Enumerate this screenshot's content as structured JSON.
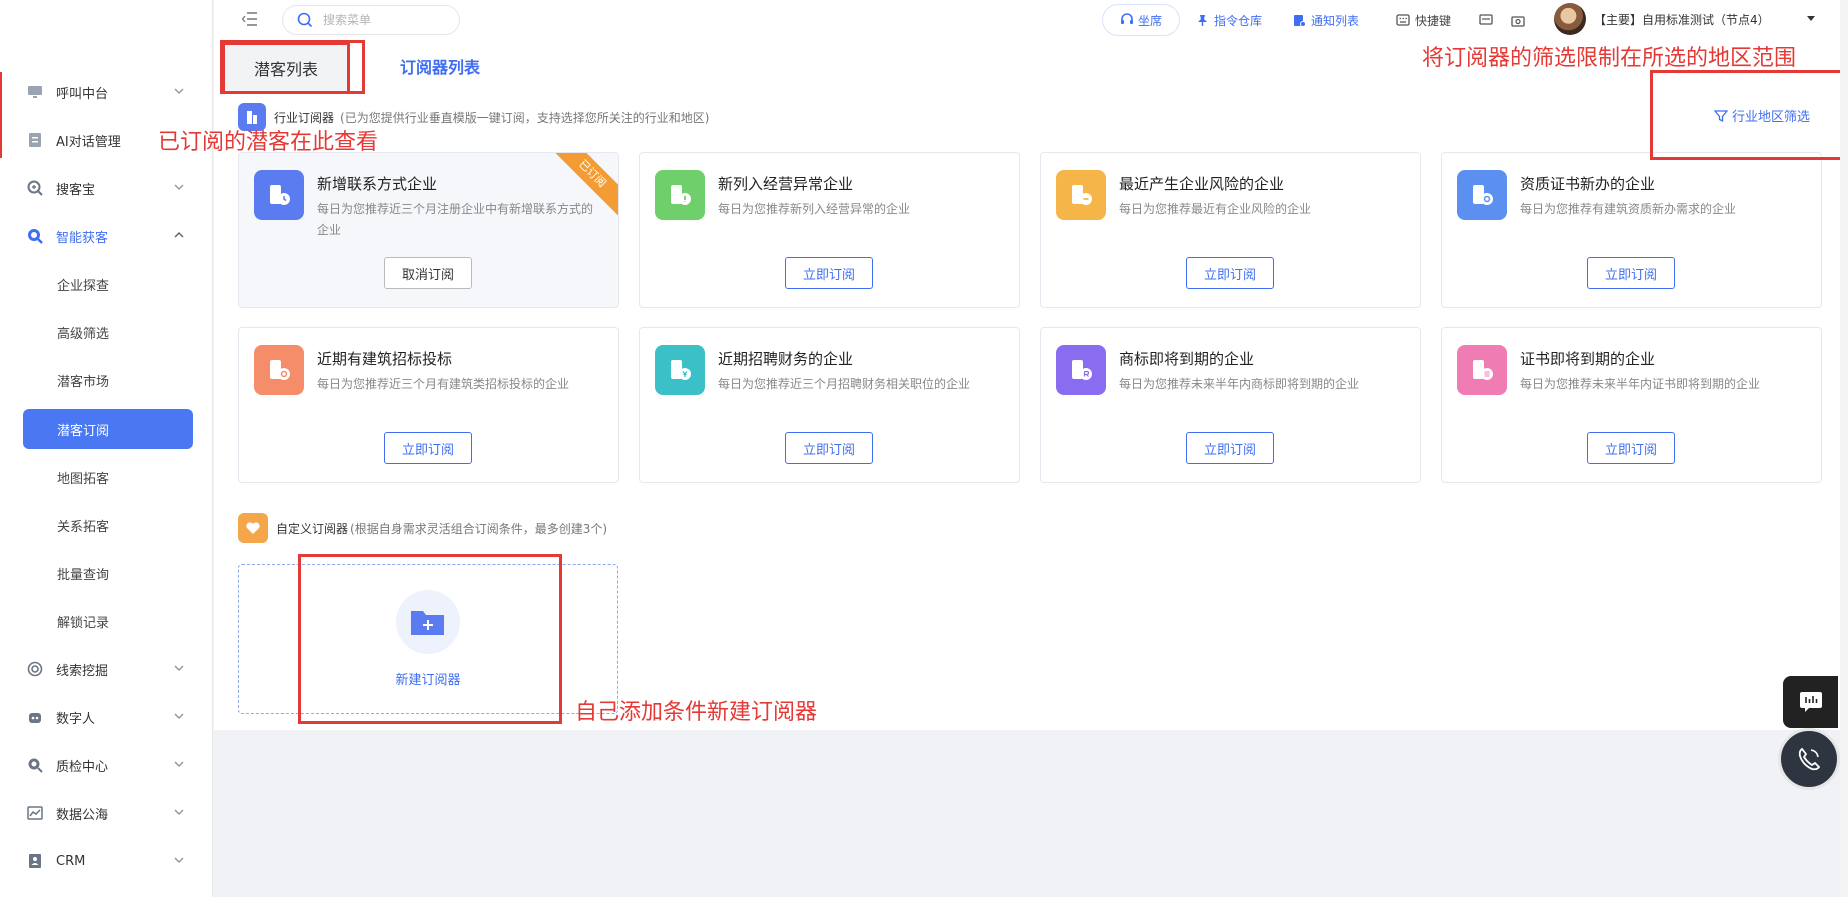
{
  "sidebar": {
    "menu": [
      {
        "label": "呼叫中台",
        "icon": "monitor-icon"
      },
      {
        "label": "AI对话管理",
        "icon": "document-icon"
      },
      {
        "label": "搜客宝",
        "icon": "search-plus-icon"
      },
      {
        "label": "智能获客",
        "icon": "search-icon"
      }
    ],
    "sub": [
      "企业探查",
      "高级筛选",
      "潜客市场",
      "潜客订阅",
      "地图拓客",
      "关系拓客",
      "批量查询",
      "解锁记录"
    ],
    "bottom_menu": [
      {
        "label": "线索挖掘",
        "icon": "target-icon"
      },
      {
        "label": "数字人",
        "icon": "robot-icon"
      },
      {
        "label": "质检中心",
        "icon": "magnifier-icon"
      },
      {
        "label": "数据公海",
        "icon": "chart-icon"
      },
      {
        "label": "CRM",
        "icon": "contact-icon"
      }
    ]
  },
  "header": {
    "search_placeholder": "搜索菜单",
    "seat": "坐席",
    "command": "指令仓库",
    "notice": "通知列表",
    "shortcut": "快捷键",
    "user": "【主要】自用标准测试（节点4）"
  },
  "tabs": [
    "潜客列表",
    "订阅器列表"
  ],
  "industry": {
    "title": "行业订阅器",
    "desc": "(已为您提供行业垂直模版一键订阅，支持选择您所关注的行业和地区)",
    "filter": "行业地区筛选"
  },
  "cards": [
    {
      "title": "新增联系方式企业",
      "desc": "每日为您推荐近三个月注册企业中有新增联系方式的企业",
      "btn": "取消订阅",
      "ribbon": "已订阅",
      "color": "#5b7cf0"
    },
    {
      "title": "新列入经营异常企业",
      "desc": "每日为您推荐新列入经营异常的企业",
      "btn": "立即订阅",
      "color": "#6fcf6a"
    },
    {
      "title": "最近产生企业风险的企业",
      "desc": "每日为您推荐最近有企业风险的企业",
      "btn": "立即订阅",
      "color": "#f5b548"
    },
    {
      "title": "资质证书新办的企业",
      "desc": "每日为您推荐有建筑资质新办需求的企业",
      "btn": "立即订阅",
      "color": "#5b8ff0"
    },
    {
      "title": "近期有建筑招标投标",
      "desc": "每日为您推荐近三个月有建筑类招标投标的企业",
      "btn": "立即订阅",
      "color": "#f58c6a"
    },
    {
      "title": "近期招聘财务的企业",
      "desc": "每日为您推荐近三个月招聘财务相关职位的企业",
      "btn": "立即订阅",
      "color": "#3cc0c8"
    },
    {
      "title": "商标即将到期的企业",
      "desc": "每日为您推荐未来半年内商标即将到期的企业",
      "btn": "立即订阅",
      "color": "#8a6cf0"
    },
    {
      "title": "证书即将到期的企业",
      "desc": "每日为您推荐未来半年内证书即将到期的企业",
      "btn": "立即订阅",
      "color": "#f07cb4"
    }
  ],
  "custom": {
    "title": "自定义订阅器",
    "desc": "(根据自身需求灵活组合订阅条件，最多创建3个)",
    "new": "新建订阅器"
  },
  "annotations": {
    "a1": "已订阅的潜客在此查看",
    "a2": "将订阅器的筛选限制在所选的地区范围",
    "a3": "自己添加条件新建订阅器"
  },
  "colors": {
    "accent": "#3f6ef3",
    "annotation": "#e53935"
  }
}
